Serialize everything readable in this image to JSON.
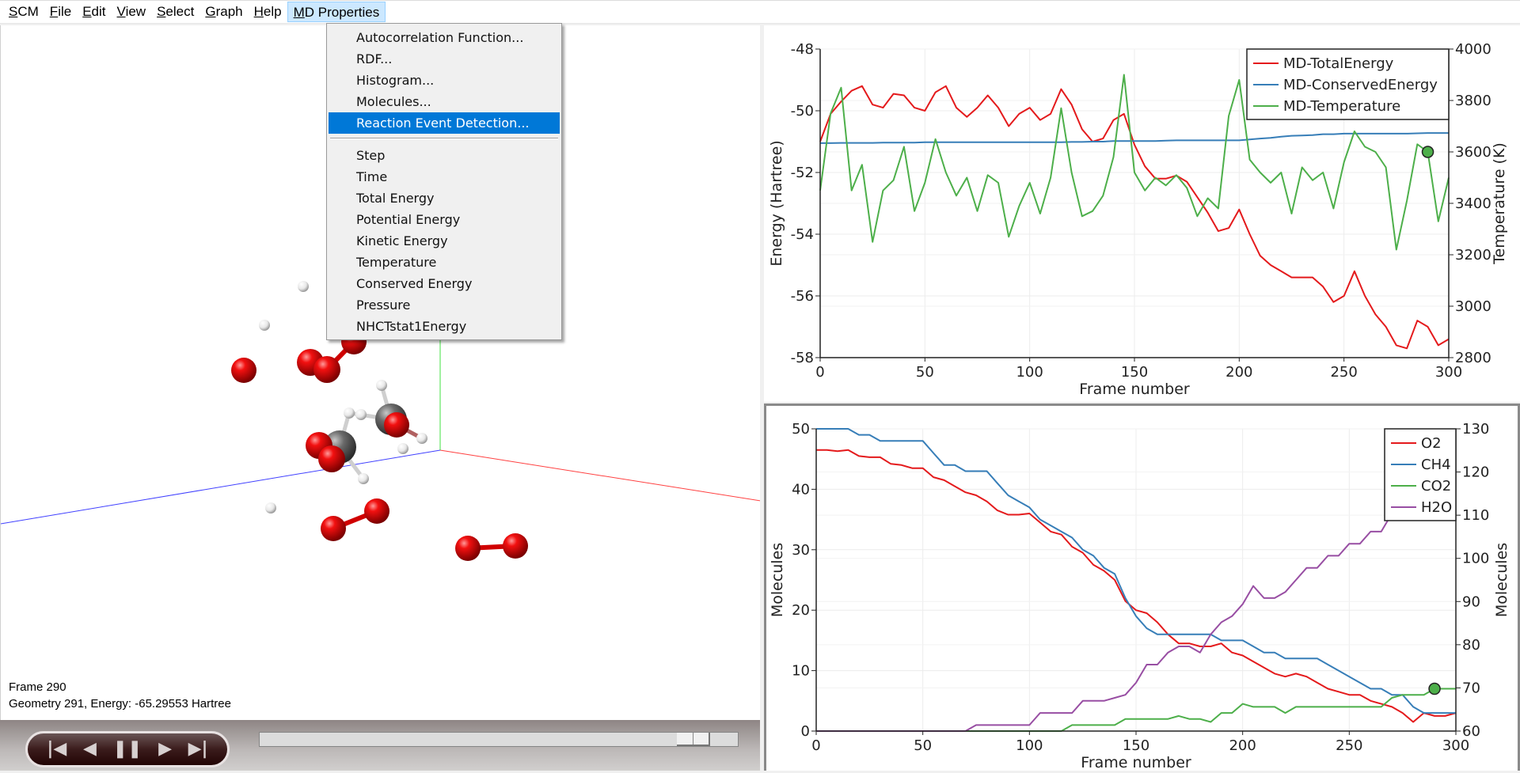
{
  "menubar": {
    "items": [
      {
        "label": "SCM",
        "mnemonic": "S"
      },
      {
        "label": "File",
        "mnemonic": "F"
      },
      {
        "label": "Edit",
        "mnemonic": "E"
      },
      {
        "label": "View",
        "mnemonic": "V"
      },
      {
        "label": "Select",
        "mnemonic": "S"
      },
      {
        "label": "Graph",
        "mnemonic": "G"
      },
      {
        "label": "Help",
        "mnemonic": "H"
      },
      {
        "label": "MD Properties",
        "mnemonic": "M",
        "active": true
      }
    ]
  },
  "md_menu": {
    "group1": [
      "Autocorrelation Function...",
      "RDF...",
      "Histogram...",
      "Molecules...",
      "Reaction Event Detection..."
    ],
    "highlighted": "Reaction Event Detection...",
    "group2": [
      "Step",
      "Time",
      "Total Energy",
      "Potential Energy",
      "Kinetic Energy",
      "Temperature",
      "Conserved Energy",
      "Pressure",
      "NHCTstat1Energy"
    ]
  },
  "viewer": {
    "frame_label": "Frame 290",
    "geometry_label": "Geometry 291, Energy: -65.29553 Hartree",
    "axis_colors": {
      "x": "#ff0000",
      "y": "#00cc00",
      "z": "#0000ff"
    },
    "atom_colors": {
      "O": "#e00000",
      "C": "#606060",
      "H": "#f4f4f4"
    }
  },
  "playback": {
    "buttons": [
      "first-frame",
      "previous-frame",
      "pause",
      "next-frame",
      "last-frame"
    ],
    "current_frame": 290,
    "total_frames": 300
  },
  "chart_data": [
    {
      "type": "line",
      "title": "",
      "xlabel": "Frame number",
      "ylabel": "Energy (Hartree)",
      "y2label": "Temperature (K)",
      "xlim": [
        0,
        300
      ],
      "ylim": [
        -58,
        -48
      ],
      "y2lim": [
        2800,
        4000
      ],
      "xticks": [
        0,
        50,
        100,
        150,
        200,
        250,
        300
      ],
      "yticks": [
        -48,
        -50,
        -52,
        -54,
        -56,
        -58
      ],
      "y2ticks": [
        4000,
        3800,
        3600,
        3400,
        3200,
        3000,
        2800
      ],
      "grid": true,
      "legend": "top-right",
      "marker": {
        "series": "MD-Temperature",
        "x": 290,
        "y": 3600
      },
      "x": [
        0,
        5,
        10,
        15,
        20,
        25,
        30,
        35,
        40,
        45,
        50,
        55,
        60,
        65,
        70,
        75,
        80,
        85,
        90,
        95,
        100,
        105,
        110,
        115,
        120,
        125,
        130,
        135,
        140,
        145,
        150,
        155,
        160,
        165,
        170,
        175,
        180,
        185,
        190,
        195,
        200,
        205,
        210,
        215,
        220,
        225,
        230,
        235,
        240,
        245,
        250,
        255,
        260,
        265,
        270,
        275,
        280,
        285,
        290,
        295,
        300
      ],
      "series": [
        {
          "name": "MD-TotalEnergy",
          "color": "#e41a1c",
          "axis": "left",
          "values": [
            -51.0,
            -50.1,
            -49.7,
            -49.35,
            -49.2,
            -49.8,
            -49.9,
            -49.45,
            -49.5,
            -49.9,
            -50.0,
            -49.4,
            -49.2,
            -49.9,
            -50.2,
            -49.9,
            -49.5,
            -49.9,
            -50.5,
            -50.1,
            -49.9,
            -50.3,
            -50.1,
            -49.3,
            -49.8,
            -50.6,
            -51.0,
            -50.9,
            -50.3,
            -50.1,
            -51.1,
            -51.8,
            -52.2,
            -52.2,
            -52.1,
            -52.3,
            -52.8,
            -53.3,
            -53.9,
            -53.8,
            -53.2,
            -54.0,
            -54.7,
            -55.0,
            -55.2,
            -55.4,
            -55.4,
            -55.4,
            -55.7,
            -56.2,
            -56.0,
            -55.2,
            -56.0,
            -56.6,
            -57.0,
            -57.6,
            -57.7,
            -56.8,
            -57.0,
            -57.6,
            -57.4
          ]
        },
        {
          "name": "MD-ConservedEnergy",
          "color": "#377eb8",
          "axis": "left",
          "values": [
            -51.05,
            -51.05,
            -51.04,
            -51.04,
            -51.04,
            -51.04,
            -51.03,
            -51.03,
            -51.03,
            -51.03,
            -51.02,
            -51.02,
            -51.02,
            -51.02,
            -51.02,
            -51.02,
            -51.02,
            -51.02,
            -51.02,
            -51.02,
            -51.02,
            -51.02,
            -51.02,
            -51.02,
            -51.01,
            -51.01,
            -51.0,
            -51.0,
            -50.98,
            -50.98,
            -50.98,
            -50.98,
            -50.98,
            -50.97,
            -50.96,
            -50.96,
            -50.96,
            -50.96,
            -50.96,
            -50.96,
            -50.96,
            -50.93,
            -50.9,
            -50.88,
            -50.84,
            -50.81,
            -50.8,
            -50.79,
            -50.76,
            -50.76,
            -50.74,
            -50.74,
            -50.74,
            -50.74,
            -50.74,
            -50.74,
            -50.74,
            -50.73,
            -50.72,
            -50.72,
            -50.72
          ]
        },
        {
          "name": "MD-Temperature",
          "color": "#4daf4a",
          "axis": "right",
          "values": [
            3450,
            3750,
            3850,
            3450,
            3550,
            3250,
            3450,
            3490,
            3620,
            3370,
            3480,
            3650,
            3520,
            3430,
            3500,
            3370,
            3510,
            3480,
            3270,
            3390,
            3480,
            3360,
            3500,
            3770,
            3520,
            3350,
            3370,
            3430,
            3580,
            3900,
            3520,
            3450,
            3500,
            3470,
            3510,
            3460,
            3350,
            3420,
            3380,
            3740,
            3880,
            3570,
            3520,
            3480,
            3520,
            3360,
            3540,
            3490,
            3520,
            3380,
            3560,
            3680,
            3620,
            3600,
            3540,
            3220,
            3410,
            3630,
            3600,
            3330,
            3500
          ]
        }
      ]
    },
    {
      "type": "line",
      "title": "",
      "xlabel": "Frame number",
      "ylabel": "Molecules",
      "y2label": "Molecules",
      "xlim": [
        0,
        300
      ],
      "ylim": [
        0,
        50
      ],
      "y2lim": [
        60,
        130
      ],
      "xticks": [
        0,
        50,
        100,
        150,
        200,
        250,
        300
      ],
      "yticks": [
        0,
        10,
        20,
        30,
        40,
        50
      ],
      "y2ticks": [
        60,
        70,
        80,
        90,
        100,
        110,
        120,
        130
      ],
      "grid": true,
      "legend": "top-right",
      "marker": {
        "series": "CO2",
        "x": 290,
        "y": 7
      },
      "x": [
        0,
        5,
        10,
        15,
        20,
        25,
        30,
        35,
        40,
        45,
        50,
        55,
        60,
        65,
        70,
        75,
        80,
        85,
        90,
        95,
        100,
        105,
        110,
        115,
        120,
        125,
        130,
        135,
        140,
        145,
        150,
        155,
        160,
        165,
        170,
        175,
        180,
        185,
        190,
        195,
        200,
        205,
        210,
        215,
        220,
        225,
        230,
        235,
        240,
        245,
        250,
        255,
        260,
        265,
        270,
        275,
        280,
        285,
        290,
        295,
        300
      ],
      "series": [
        {
          "name": "O2",
          "color": "#e41a1c",
          "values": [
            46.5,
            46.5,
            46.3,
            46.5,
            45.5,
            45.3,
            45.3,
            44.2,
            44.0,
            43.5,
            43.5,
            42.0,
            41.5,
            40.5,
            39.5,
            39.0,
            38.0,
            36.5,
            35.8,
            35.8,
            36.0,
            34.5,
            33.0,
            32.5,
            30.5,
            29.5,
            27.5,
            26.5,
            25.0,
            21.5,
            20.0,
            19.5,
            18.0,
            16.0,
            14.5,
            14.5,
            14.0,
            14.0,
            14.5,
            13.0,
            12.5,
            11.5,
            10.5,
            9.5,
            9.0,
            9.5,
            9.0,
            8.0,
            7.0,
            6.5,
            6.0,
            6.0,
            5.0,
            4.5,
            4.0,
            3.0,
            1.5,
            3.0,
            2.5,
            2.5,
            3.0
          ]
        },
        {
          "name": "CH4",
          "color": "#377eb8",
          "values": [
            50,
            50,
            50,
            50,
            49,
            49,
            48,
            48,
            48,
            48,
            48,
            46,
            44,
            44,
            43,
            43,
            43,
            41,
            39,
            38,
            37,
            35,
            34,
            33,
            32,
            30,
            29,
            27,
            26,
            22,
            19,
            17,
            16,
            16,
            16,
            16,
            16,
            16,
            15,
            15,
            15,
            14,
            13,
            13,
            12,
            12,
            12,
            12,
            11,
            10,
            9,
            8,
            7,
            7,
            6,
            6,
            4,
            3,
            3,
            3,
            3
          ]
        },
        {
          "name": "CO2",
          "color": "#4daf4a",
          "values": [
            0,
            0,
            0,
            0,
            0,
            0,
            0,
            0,
            0,
            0,
            0,
            0,
            0,
            0,
            0,
            0,
            0,
            0,
            0,
            0,
            0,
            0,
            0,
            0,
            1,
            1,
            1,
            1,
            1,
            2,
            2,
            2,
            2,
            2,
            2.5,
            2,
            2,
            1.5,
            3,
            3,
            4.5,
            4,
            4,
            4,
            3,
            4,
            4,
            4,
            4,
            4,
            4,
            4,
            4,
            4,
            5.5,
            6,
            6,
            6,
            7,
            7,
            7
          ]
        },
        {
          "name": "H2O",
          "color": "#984ea3",
          "values": [
            0,
            0,
            0,
            0,
            0,
            0,
            0,
            0,
            0,
            0,
            0,
            0,
            0,
            0,
            0,
            1,
            1,
            1,
            1,
            1,
            1,
            3,
            3,
            3,
            3,
            5,
            5,
            5,
            5.5,
            6,
            8,
            11,
            11,
            13,
            14,
            14,
            13,
            16,
            18,
            19,
            21,
            24,
            22,
            22,
            23,
            25,
            27,
            27,
            29,
            29,
            31,
            31,
            33,
            33,
            36,
            37,
            38,
            39,
            40,
            41,
            42
          ]
        }
      ]
    }
  ]
}
